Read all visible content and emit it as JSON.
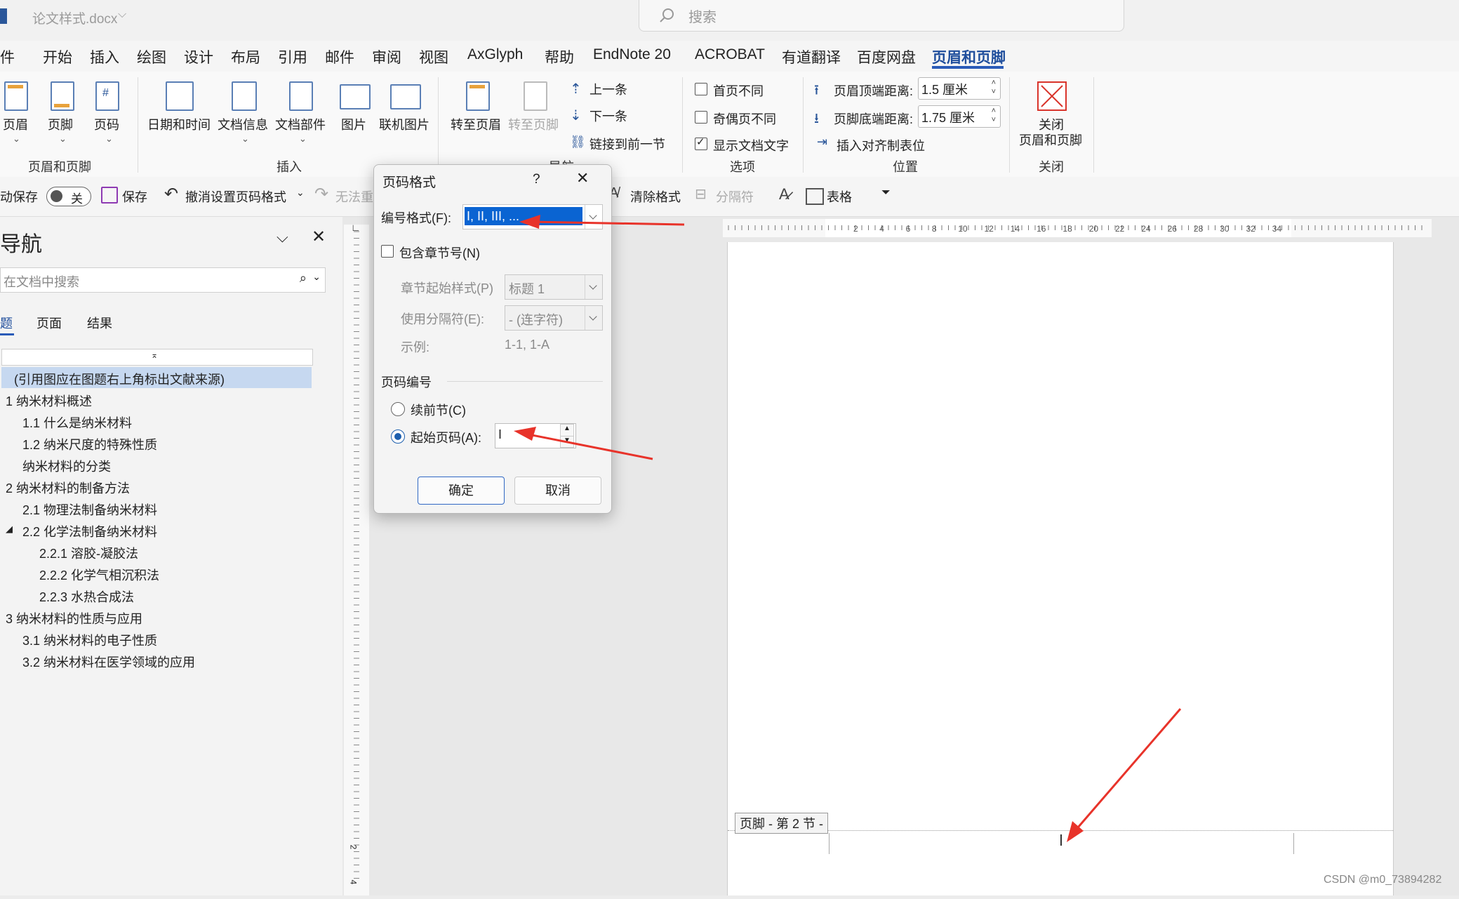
{
  "window": {
    "filename": "论文样式.docx",
    "search_placeholder": "搜索"
  },
  "menu": {
    "items": [
      "文件",
      "开始",
      "插入",
      "绘图",
      "设计",
      "布局",
      "引用",
      "邮件",
      "审阅",
      "视图",
      "AxGlyph",
      "帮助",
      "EndNote 20",
      "ACROBAT",
      "有道翻译",
      "百度网盘",
      "页眉和页脚"
    ],
    "active": "页眉和页脚"
  },
  "ribbon": {
    "header": "页眉",
    "footer": "页脚",
    "page_number": "页码",
    "group_header_footer": "页眉和页脚",
    "date_time": "日期和时间",
    "doc_info": "文档信息",
    "doc_parts": "文档部件",
    "picture": "图片",
    "online_picture": "联机图片",
    "group_insert": "插入",
    "goto_header": "转至页眉",
    "goto_footer": "转至页脚",
    "prev": "上一条",
    "next": "下一条",
    "link_prev": "链接到前一节",
    "group_nav": "导航",
    "diff_first": "首页不同",
    "diff_odd_even": "奇偶页不同",
    "show_doc_text": "显示文档文字",
    "group_options": "选项",
    "header_top_label": "页眉顶端距离:",
    "header_top_value": "1.5 厘米",
    "footer_bottom_label": "页脚底端距离:",
    "footer_bottom_value": "1.75 厘米",
    "insert_align_tab": "插入对齐制表位",
    "group_position": "位置",
    "close_line1": "关闭",
    "close_line2": "页眉和页脚",
    "group_close": "关闭",
    "checks": {
      "diff_first": false,
      "diff_odd_even": false,
      "show_doc_text": true
    }
  },
  "qat": {
    "autosave": "动保存",
    "autosave_state": "关",
    "save": "保存",
    "undo": "撤消设置页码格式",
    "redo": "无法重",
    "clear_format": "清除格式",
    "separator": "分隔符",
    "table": "表格"
  },
  "nav": {
    "title": "导航",
    "search_placeholder": "在文档中搜索",
    "tabs": [
      "标题",
      "页面",
      "结果"
    ],
    "items": [
      {
        "text": "(引用图应在图题右上角标出文献来源)",
        "level": 0,
        "selected": true
      },
      {
        "text": "1 纳米材料概述",
        "level": 0
      },
      {
        "text": "1.1 什么是纳米材料",
        "level": 1
      },
      {
        "text": "1.2 纳米尺度的特殊性质",
        "level": 1
      },
      {
        "text": "纳米材料的分类",
        "level": 1
      },
      {
        "text": "2 纳米材料的制备方法",
        "level": 0
      },
      {
        "text": "2.1 物理法制备纳米材料",
        "level": 1
      },
      {
        "text": "2.2 化学法制备纳米材料",
        "level": 1
      },
      {
        "text": "2.2.1 溶胶-凝胶法",
        "level": 2
      },
      {
        "text": "2.2.2 化学气相沉积法",
        "level": 2
      },
      {
        "text": "2.2.3 水热合成法",
        "level": 2
      },
      {
        "text": "3 纳米材料的性质与应用",
        "level": 0
      },
      {
        "text": "3.1 纳米材料的电子性质",
        "level": 1
      },
      {
        "text": "3.2 纳米材料在医学领域的应用",
        "level": 1
      }
    ]
  },
  "ruler": {
    "ticks": [
      "2",
      "4",
      "6",
      "8",
      "10",
      "12",
      "14",
      "16",
      "18",
      "20",
      "22",
      "24",
      "26",
      "28",
      "30",
      "32",
      "34"
    ],
    "vticks": [
      "2",
      "4"
    ]
  },
  "dialog": {
    "title": "页码格式",
    "help": "?",
    "number_format_label": "编号格式(F):",
    "number_format_value": "I, II, III, ...",
    "include_chapter_label": "包含章节号(N)",
    "include_chapter_checked": false,
    "chapter_style_label": "章节起始样式(P)",
    "chapter_style_value": "标题 1",
    "separator_label": "使用分隔符(E):",
    "separator_value": "-   (连字符)",
    "example_label": "示例:",
    "example_value": "1-1, 1-A",
    "page_numbering_header": "页码编号",
    "continue_label": "续前节(C)",
    "start_at_label": "起始页码(A):",
    "start_at_value": "I",
    "start_at_selected": true,
    "ok": "确定",
    "cancel": "取消"
  },
  "footer_tag": "页脚 - 第 2 节 -",
  "watermark": "CSDN @m0_73894282"
}
